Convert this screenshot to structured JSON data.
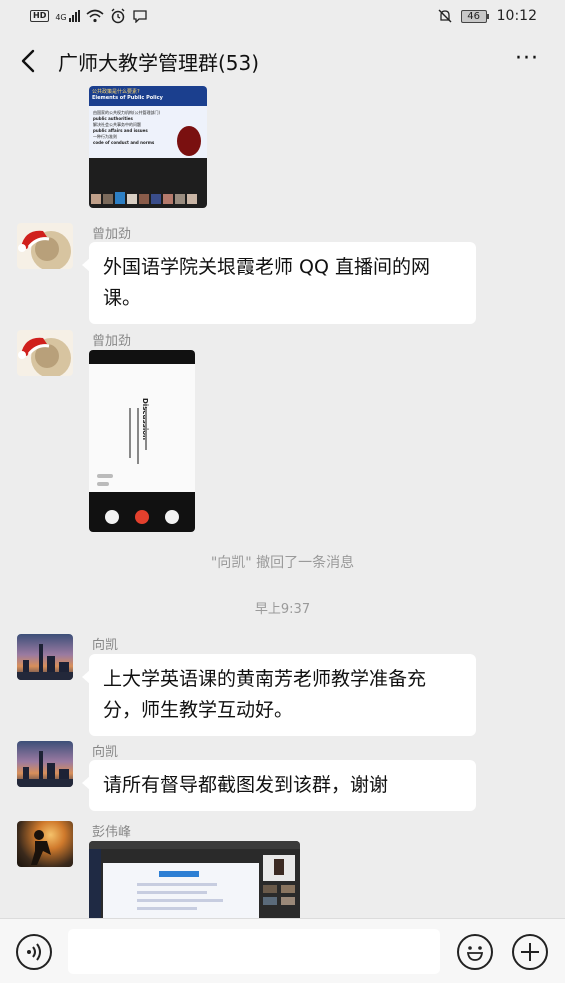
{
  "status_bar": {
    "hd": "HD",
    "network": "4G",
    "battery": "46",
    "time": "10:12"
  },
  "header": {
    "title": "广师大教学管理群(53)",
    "more_label": "···"
  },
  "messages": [
    {
      "type": "image",
      "desc_title": "公共政策是什么要素?",
      "desc_subtitle": "Elements of Public Policy",
      "slide_lines": [
        "由国家的公共权力机构(公共管理部门)",
        "public authorities",
        "解决社会公共事务中的问题",
        "public affairs and issues",
        "一种行为准则",
        "code of conduct and norms"
      ]
    },
    {
      "type": "text",
      "sender": "曾加劲",
      "text": "外国语学院关垠霞老师 QQ 直播间的网课。"
    },
    {
      "type": "image",
      "sender": "曾加劲",
      "slide_title": "Discussion"
    },
    {
      "type": "system",
      "text": "\"向凯\" 撤回了一条消息"
    },
    {
      "type": "time",
      "text": "早上9:37"
    },
    {
      "type": "text",
      "sender": "向凯",
      "text": "上大学英语课的黄南芳老师教学准备充分，师生教学互动好。"
    },
    {
      "type": "text",
      "sender": "向凯",
      "text": "请所有督导都截图发到该群，谢谢"
    },
    {
      "type": "image",
      "sender": "彭伟峰"
    }
  ],
  "input_bar": {
    "voice_icon": "voice-icon",
    "emoji_icon": "emoji-icon",
    "plus_icon": "plus-icon",
    "placeholder": ""
  }
}
